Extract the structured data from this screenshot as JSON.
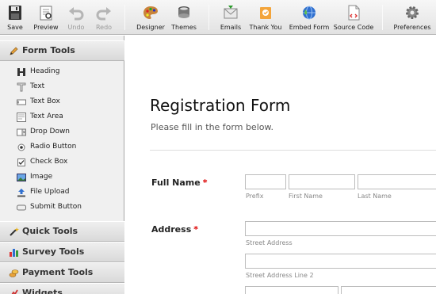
{
  "toolbar": {
    "save": "Save",
    "preview": "Preview",
    "undo": "Undo",
    "redo": "Redo",
    "designer": "Designer",
    "themes": "Themes",
    "emails": "Emails",
    "thank_you": "Thank You",
    "embed_form": "Embed Form",
    "source_code": "Source Code",
    "preferences": "Preferences"
  },
  "sidebar": {
    "form_tools": {
      "title": "Form Tools",
      "items": [
        {
          "label": "Heading",
          "icon": "heading-icon"
        },
        {
          "label": "Text",
          "icon": "text-icon"
        },
        {
          "label": "Text Box",
          "icon": "textbox-icon"
        },
        {
          "label": "Text Area",
          "icon": "textarea-icon"
        },
        {
          "label": "Drop Down",
          "icon": "dropdown-icon"
        },
        {
          "label": "Radio Button",
          "icon": "radio-icon"
        },
        {
          "label": "Check Box",
          "icon": "checkbox-icon"
        },
        {
          "label": "Image",
          "icon": "image-icon"
        },
        {
          "label": "File Upload",
          "icon": "upload-icon"
        },
        {
          "label": "Submit Button",
          "icon": "submit-icon"
        }
      ]
    },
    "quick_tools": "Quick Tools",
    "survey_tools": "Survey Tools",
    "payment_tools": "Payment Tools",
    "widgets": "Widgets"
  },
  "form": {
    "title": "Registration Form",
    "subtitle": "Please fill in the form below.",
    "full_name": {
      "label": "Full Name",
      "required": "*",
      "prefix": "Prefix",
      "first": "First Name",
      "last": "Last Name"
    },
    "address": {
      "label": "Address",
      "required": "*",
      "street": "Street Address",
      "street2": "Street Address Line 2"
    }
  },
  "colors": {
    "required": "#dd0000",
    "toolbar_bg": "#e8e8e8",
    "sidebar_bg": "#f0f0f0"
  }
}
